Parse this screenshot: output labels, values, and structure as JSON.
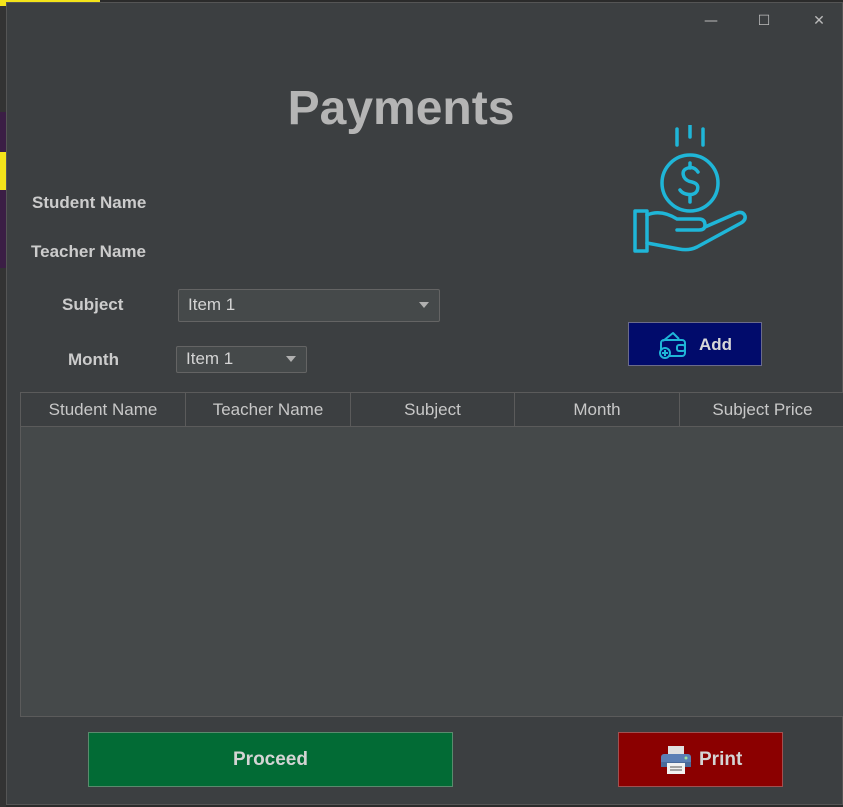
{
  "window": {
    "minimize_glyph": "—",
    "maximize_glyph": "☐",
    "close_glyph": "✕"
  },
  "title": "Payments",
  "form": {
    "student_name_label": "Student Name",
    "teacher_name_label": "Teacher Name",
    "subject_label": "Subject",
    "subject_value": "Item 1",
    "month_label": "Month",
    "month_value": "Item 1"
  },
  "buttons": {
    "add_label": "Add",
    "proceed_label": "Proceed",
    "print_label": "Print"
  },
  "table": {
    "columns": [
      "Student Name",
      "Teacher Name",
      "Subject",
      "Month",
      "Subject Price"
    ],
    "rows": []
  },
  "icons": {
    "payment": "hand-coin-dollar-icon",
    "add": "wallet-add-icon",
    "print": "printer-icon"
  },
  "colors": {
    "add_button": "#010b6b",
    "proceed_button": "#026b35",
    "print_button": "#8b0000",
    "icon_accent": "#1fb6d8"
  }
}
